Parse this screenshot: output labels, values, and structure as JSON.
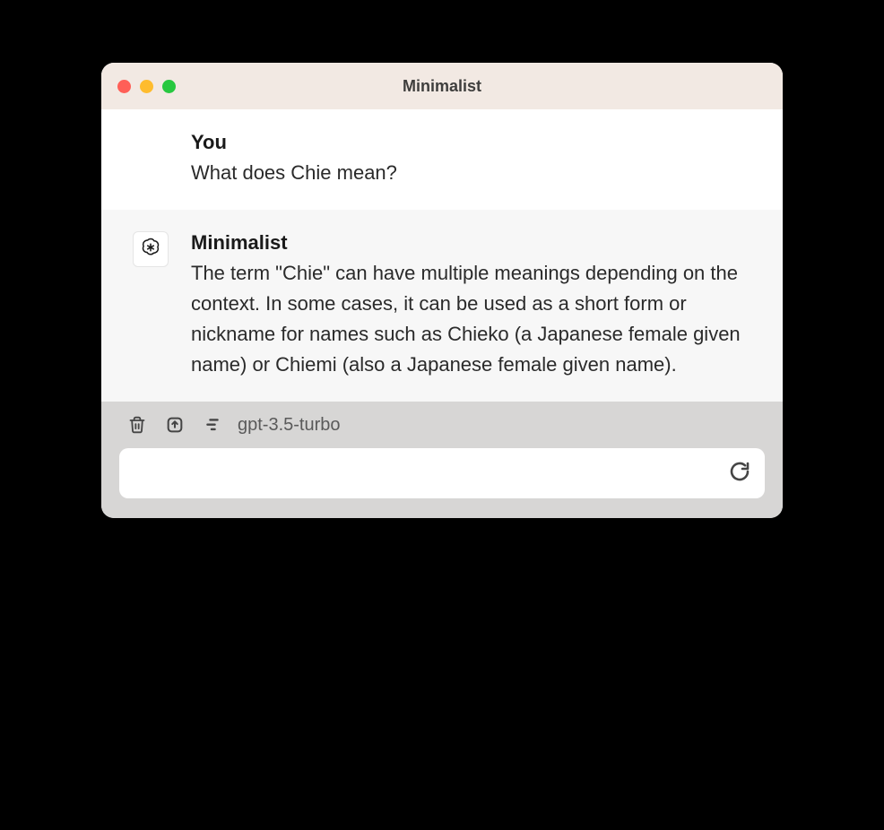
{
  "window": {
    "title": "Minimalist"
  },
  "messages": [
    {
      "sender": "You",
      "text": "What does Chie mean?",
      "role": "user"
    },
    {
      "sender": "Minimalist",
      "text": "The term \"Chie\" can have multiple meanings depending on the context. In some cases, it can be used as a short form or nickname for names such as Chieko (a Japanese female given name) or Chiemi (also a Japanese female given name).",
      "role": "assistant"
    }
  ],
  "footer": {
    "model": "gpt-3.5-turbo",
    "input_value": ""
  }
}
